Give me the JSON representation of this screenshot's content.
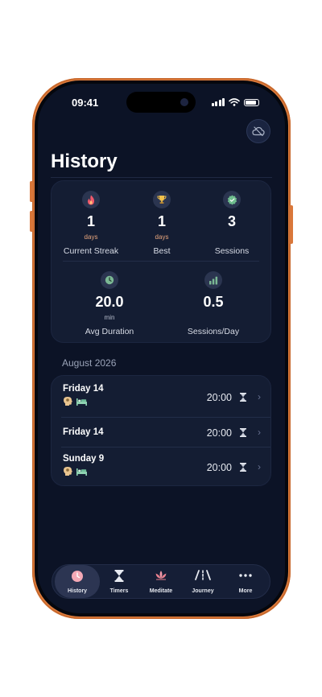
{
  "status_bar": {
    "time": "09:41"
  },
  "header": {
    "title": "History"
  },
  "stats": [
    {
      "icon": "flame-icon",
      "value": "1",
      "unit": "days",
      "label": "Current Streak"
    },
    {
      "icon": "trophy-icon",
      "value": "1",
      "unit": "days",
      "label": "Best"
    },
    {
      "icon": "verified-badge-icon",
      "value": "3",
      "unit": "",
      "label": "Sessions"
    },
    {
      "icon": "clock-icon",
      "value": "20.0",
      "unit": "min",
      "label": "Avg Duration"
    },
    {
      "icon": "bar-chart-icon",
      "value": "0.5",
      "unit": "",
      "label": "Sessions/Day"
    }
  ],
  "month": "August 2026",
  "sessions": [
    {
      "day": "Friday 14",
      "time": "20:00",
      "tags": [
        "head-icon",
        "bed-icon"
      ]
    },
    {
      "day": "Friday 14",
      "time": "20:00",
      "tags": []
    },
    {
      "day": "Sunday 9",
      "time": "20:00",
      "tags": [
        "head-icon",
        "bed-icon"
      ]
    }
  ],
  "tabs": [
    {
      "label": "History",
      "icon": "clock-icon",
      "active": true
    },
    {
      "label": "Timers",
      "icon": "hourglass-icon",
      "active": false
    },
    {
      "label": "Meditate",
      "icon": "lotus-icon",
      "active": false
    },
    {
      "label": "Journey",
      "icon": "road-icon",
      "active": false
    },
    {
      "label": "More",
      "icon": "more-dots-icon",
      "active": false
    }
  ],
  "colors": {
    "background": "#0c1326",
    "card": "#141d33",
    "accent": "#e9a77e",
    "frame": "#e27f3f"
  }
}
